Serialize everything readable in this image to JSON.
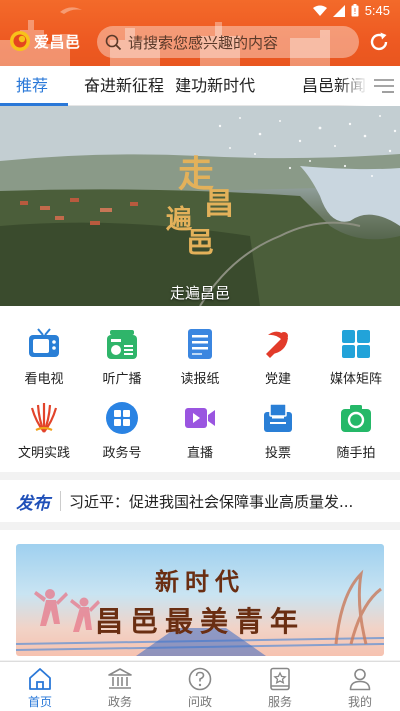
{
  "status_bar": {
    "time": "5:45"
  },
  "header": {
    "app_name": "爱昌邑",
    "search_placeholder": "请搜索您感兴趣的内容",
    "icons": [
      "app-logo",
      "search-icon",
      "refresh-icon"
    ]
  },
  "tabs": [
    {
      "label": "推荐",
      "active": true
    },
    {
      "label": "奋进新征程  建功新时代",
      "active": false
    },
    {
      "label": "昌邑新闻",
      "active": false
    }
  ],
  "banner": {
    "title_art": "走遍昌邑",
    "caption": "走遍昌邑"
  },
  "grid": [
    {
      "label": "看电视",
      "icon": "tv-icon"
    },
    {
      "label": "听广播",
      "icon": "radio-icon"
    },
    {
      "label": "读报纸",
      "icon": "newspaper-icon"
    },
    {
      "label": "党建",
      "icon": "party-emblem-icon"
    },
    {
      "label": "媒体矩阵",
      "icon": "media-matrix-icon"
    },
    {
      "label": "文明实践",
      "icon": "civilization-practice-icon"
    },
    {
      "label": "政务号",
      "icon": "government-account-icon"
    },
    {
      "label": "直播",
      "icon": "live-video-icon"
    },
    {
      "label": "投票",
      "icon": "vote-icon"
    },
    {
      "label": "随手拍",
      "icon": "camera-icon"
    }
  ],
  "ticker": {
    "source": "发布",
    "headline": "习近平：促进我国社会保障事业高质量发..."
  },
  "promo": {
    "line1": "新时代",
    "line2": "昌邑最美青年"
  },
  "bottom_nav": [
    {
      "label": "首页",
      "icon": "home-icon",
      "active": true
    },
    {
      "label": "政务",
      "icon": "government-building-icon",
      "active": false
    },
    {
      "label": "问政",
      "icon": "question-icon",
      "active": false
    },
    {
      "label": "服务",
      "icon": "service-icon",
      "active": false
    },
    {
      "label": "我的",
      "icon": "profile-icon",
      "active": false
    }
  ],
  "colors": {
    "header_orange": "#ee5a22",
    "accent_blue": "#2a78d8",
    "tab_active": "#2a78d8"
  }
}
